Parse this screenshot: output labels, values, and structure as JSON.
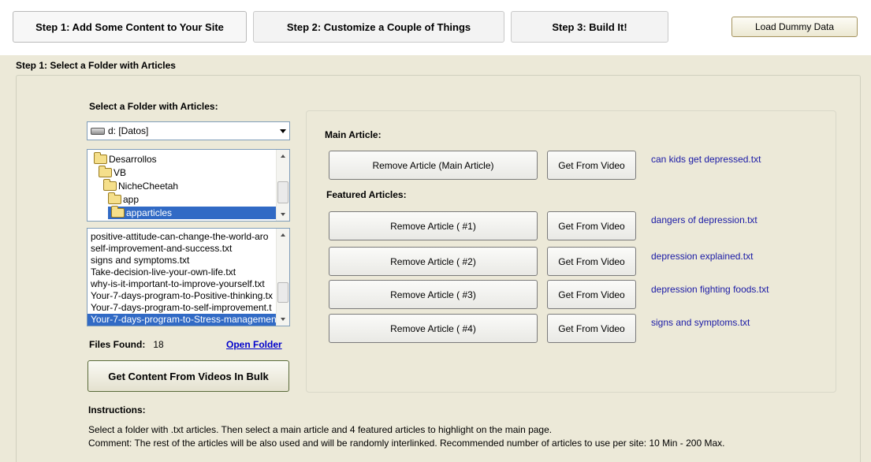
{
  "tabs": [
    {
      "label": "Step 1: Add Some Content to Your Site",
      "active": true
    },
    {
      "label": "Step 2: Customize a Couple of Things",
      "active": false
    },
    {
      "label": "Step 3: Build It!",
      "active": false
    }
  ],
  "load_dummy_label": "Load Dummy Data",
  "group_title": "Step 1: Select a Folder with Articles",
  "select_label": "Select a Folder with Articles:",
  "drive": "d: [Datos]",
  "folders": [
    "Desarrollos",
    "VB",
    "NicheCheetah",
    "app",
    "apparticles"
  ],
  "selected_folder": "apparticles",
  "files": [
    "positive-attitude-can-change-the-world-aro",
    "self-improvement-and-success.txt",
    "signs and symptoms.txt",
    "Take-decision-live-your-own-life.txt",
    "why-is-it-important-to-improve-yourself.txt",
    "Your-7-days-program-to-Positive-thinking.tx",
    "Your-7-days-program-to-self-improvement.t",
    "Your-7-days-program-to-Stress-managemen"
  ],
  "files_found_label": "Files Found:",
  "files_found_count": "18",
  "open_folder_label": "Open Folder",
  "bulk_button": "Get Content From Videos In Bulk",
  "main_article_label": "Main Article:",
  "featured_label": "Featured Articles:",
  "get_from_video": "Get From Video",
  "articles": [
    {
      "remove_label": "Remove Article (Main Article)",
      "file": "can kids get depressed.txt"
    },
    {
      "remove_label": "Remove Article ( #1)",
      "file": "dangers of depression.txt"
    },
    {
      "remove_label": "Remove Article ( #2)",
      "file": "depression explained.txt"
    },
    {
      "remove_label": "Remove Article ( #3)",
      "file": "depression fighting foods.txt"
    },
    {
      "remove_label": "Remove Article ( #4)",
      "file": "signs and symptoms.txt"
    }
  ],
  "instructions_title": "Instructions:",
  "instructions": [
    "Select a folder with .txt articles. Then select a main article and 4 featured articles to highlight on the main page.",
    "Comment: The rest of the articles will be also used and will be randomly interlinked.  Recommended number of articles to use per site: 10 Min - 200 Max."
  ]
}
